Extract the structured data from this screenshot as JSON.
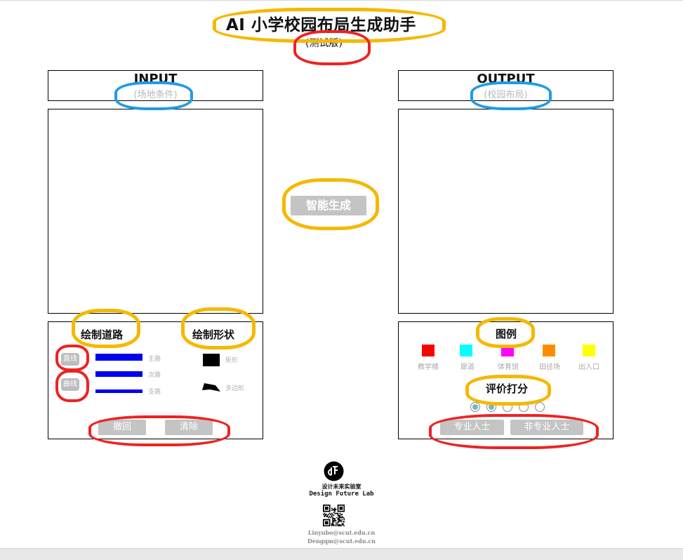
{
  "app": {
    "title": "AI  小学校园布局生成助手",
    "subtitle": "(测试版)"
  },
  "input_panel": {
    "header": "INPUT",
    "sub": "(场地条件)"
  },
  "output_panel": {
    "header": "OUTPUT",
    "sub": "(校园布局)"
  },
  "generate_button": "智能生成",
  "tools": {
    "road_title": "绘制道路",
    "shape_title": "绘制形状",
    "straight_btn": "直线",
    "curve_btn": "曲线",
    "road_types": [
      "主路",
      "次路",
      "支路"
    ],
    "shape_rect": "矩形",
    "shape_polygon": "多边形",
    "undo": "撤回",
    "clear": "清除"
  },
  "legend": {
    "title": "图例",
    "items": [
      {
        "label": "教学楼",
        "color": "#ff0000"
      },
      {
        "label": "廊道",
        "color": "#00ffff"
      },
      {
        "label": "体育馆",
        "color": "#ff00ff"
      },
      {
        "label": "田径场",
        "color": "#ff8c00"
      },
      {
        "label": "出入口",
        "color": "#ffff00"
      }
    ]
  },
  "rating": {
    "title": "评价打分",
    "selected": 2,
    "max": 5,
    "pro_button": "专业人士",
    "nonpro_button": "非专业人士"
  },
  "footer": {
    "lab_cn": "设计未来实验室",
    "lab_en": "Design  Future  Lab",
    "email1": "Linyubo@scut.edu.cn",
    "email2": "Dengqm@scut.edu.cn"
  },
  "colors": {
    "road_blue": "#0000ee",
    "button_gray": "#c4c4c4",
    "annotation_yellow": "#f5b800",
    "annotation_red": "#ee2222",
    "annotation_blue": "#1e9be8"
  }
}
